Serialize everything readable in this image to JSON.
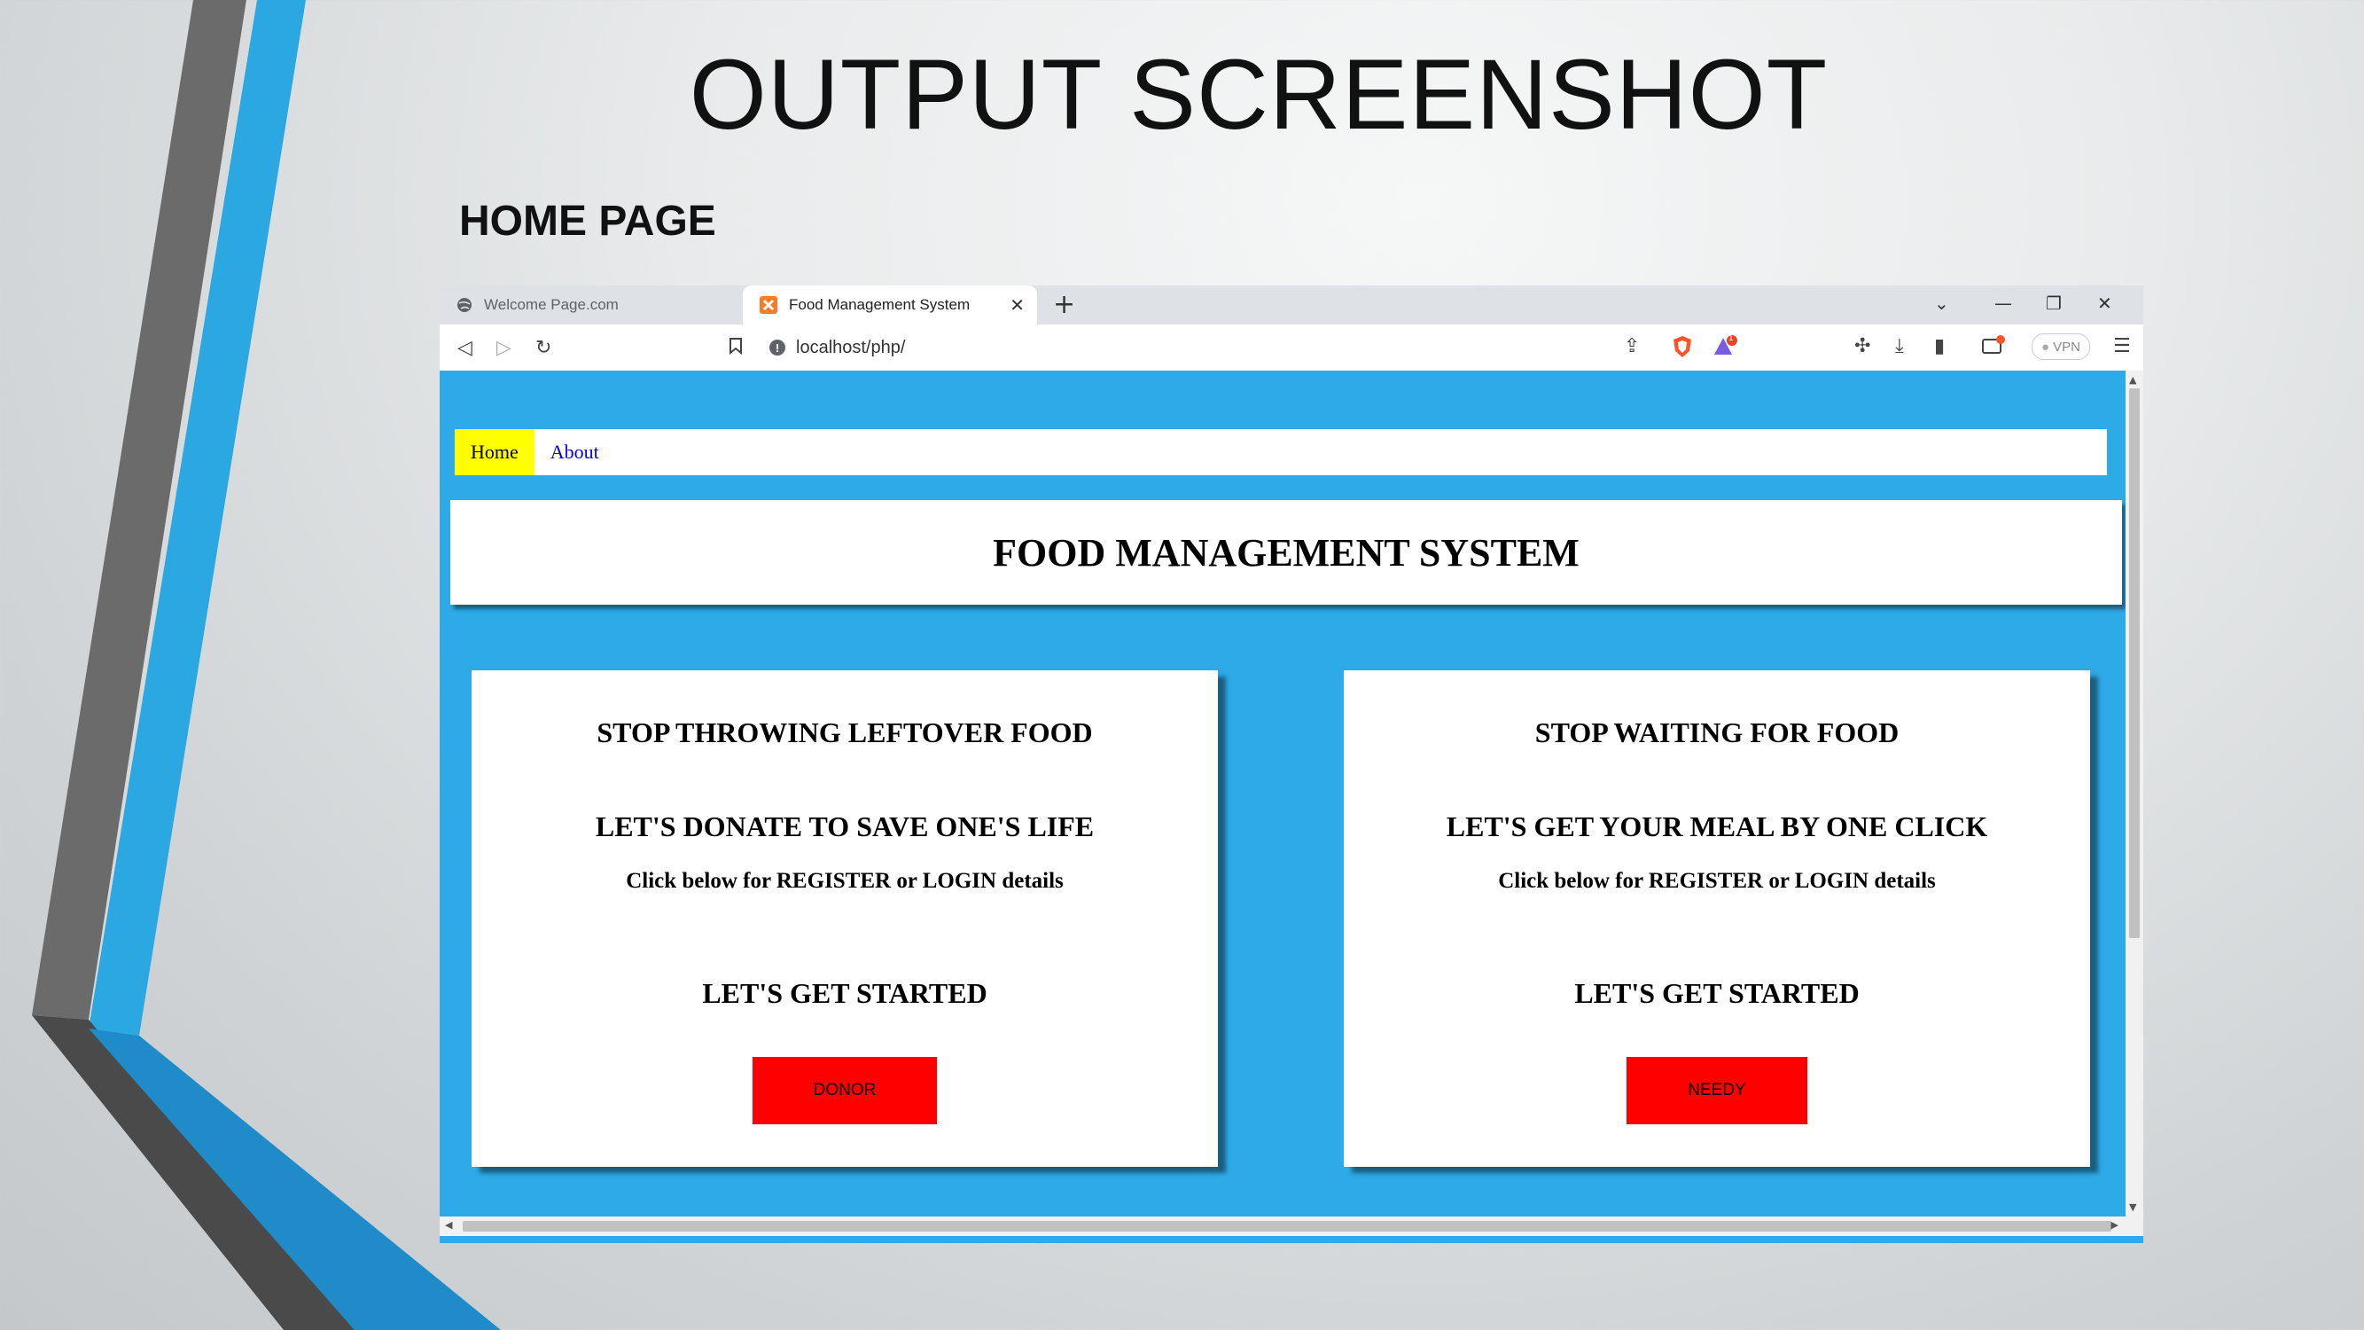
{
  "slide": {
    "title": "OUTPUT SCREENSHOT",
    "subtitle": "HOME PAGE"
  },
  "browser": {
    "tabs": [
      {
        "label": "Welcome Page.com",
        "icon": "globe-icon",
        "active": false
      },
      {
        "label": "Food Management System",
        "icon": "xampp-icon",
        "active": true
      }
    ],
    "new_tab": "+",
    "url": "localhost/php/",
    "vpn_label": "VPN",
    "notification_count": "1"
  },
  "page": {
    "nav": [
      {
        "label": "Home"
      },
      {
        "label": "About"
      }
    ],
    "header": "FOOD MANAGEMENT SYSTEM",
    "cards": [
      {
        "line1": "STOP THROWING LEFTOVER FOOD",
        "line2": "LET'S DONATE TO SAVE ONE'S LIFE",
        "line3": "Click below for REGISTER or LOGIN details",
        "line4": "LET'S GET STARTED",
        "button": "DONOR"
      },
      {
        "line1": "STOP WAITING FOR FOOD",
        "line2": "LET'S GET YOUR MEAL BY ONE CLICK",
        "line3": "Click below for REGISTER or LOGIN details",
        "line4": "LET'S GET STARTED",
        "button": "NEEDY"
      }
    ]
  },
  "colors": {
    "page_bg": "#2eaae8",
    "home_highlight": "#ffff00",
    "button_red": "#ff0000",
    "deco_blue": "#29a3df",
    "deco_gray": "#6b6b6b"
  }
}
